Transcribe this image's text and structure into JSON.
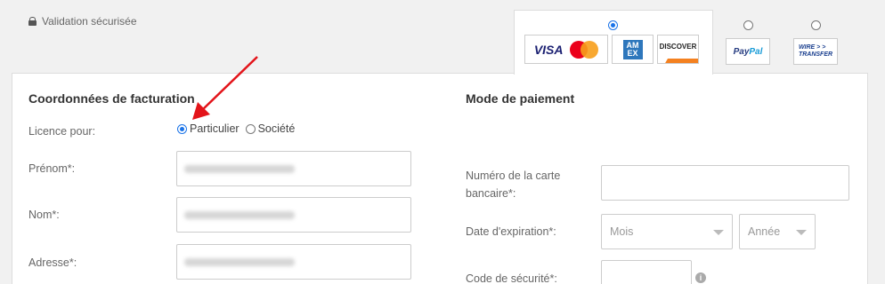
{
  "header": {
    "secure_label": "Validation sécurisée"
  },
  "payment_options": {
    "cards": {
      "visa": "VISA",
      "amex": "AM EX",
      "discover": "DISCOVER"
    },
    "paypal": {
      "label_a": "Pay",
      "label_b": "Pal"
    },
    "wire": {
      "line1": "WIRE > >",
      "line2": "TRANSFER"
    }
  },
  "billing": {
    "title": "Coordonnées de facturation",
    "license_label": "Licence pour:",
    "license_options": [
      "Particulier",
      "Société"
    ],
    "firstname_label": "Prénom*:",
    "lastname_label": "Nom*:",
    "address_label": "Adresse*:"
  },
  "payment": {
    "title": "Mode de paiement",
    "card_number_label": "Numéro de la carte bancaire*:",
    "expiry_label": "Date d'expiration*:",
    "month_placeholder": "Mois",
    "year_placeholder": "Année",
    "security_code_label": "Code de sécurité*:"
  },
  "colors": {
    "accent": "#1a73e8",
    "annotation_arrow": "#e3141a"
  }
}
